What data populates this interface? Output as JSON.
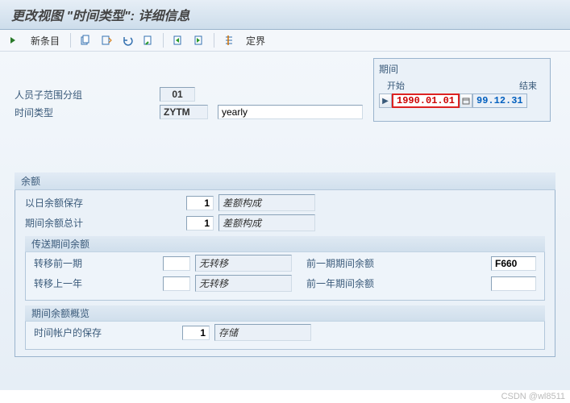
{
  "title": "更改视图 \"时间类型\":  详细信息",
  "toolbar": {
    "new_entry": "新条目",
    "delimit": "定界"
  },
  "form": {
    "subgroup_label": "人员子范围分组",
    "subgroup_value": "01",
    "time_type_label": "时间类型",
    "time_type_code": "ZYTM",
    "time_type_desc": "yearly"
  },
  "period": {
    "title": "期间",
    "start_label": "开始",
    "end_label": "结束",
    "start_date": "1990.01.01",
    "end_date": "99.12.31"
  },
  "balance": {
    "title": "余额",
    "r1_label": "以日余额保存",
    "r1_val": "1",
    "r1_desc": "差额构成",
    "r2_label": "期间余额总计",
    "r2_val": "1",
    "r2_desc": "差额构成"
  },
  "transfer": {
    "title": "传送期间余额",
    "r1_label": "转移前一期",
    "r1_val": "",
    "r1_desc": "无转移",
    "r1_right_label": "前一期期间余额",
    "r1_right_val": "F660",
    "r2_label": "转移上一年",
    "r2_val": "",
    "r2_desc": "无转移",
    "r2_right_label": "前一年期间余额",
    "r2_right_val": ""
  },
  "overview": {
    "title": "期间余额概览",
    "r1_label": "时间帐户的保存",
    "r1_val": "1",
    "r1_desc": "存储"
  },
  "watermark": "CSDN @wl8511"
}
